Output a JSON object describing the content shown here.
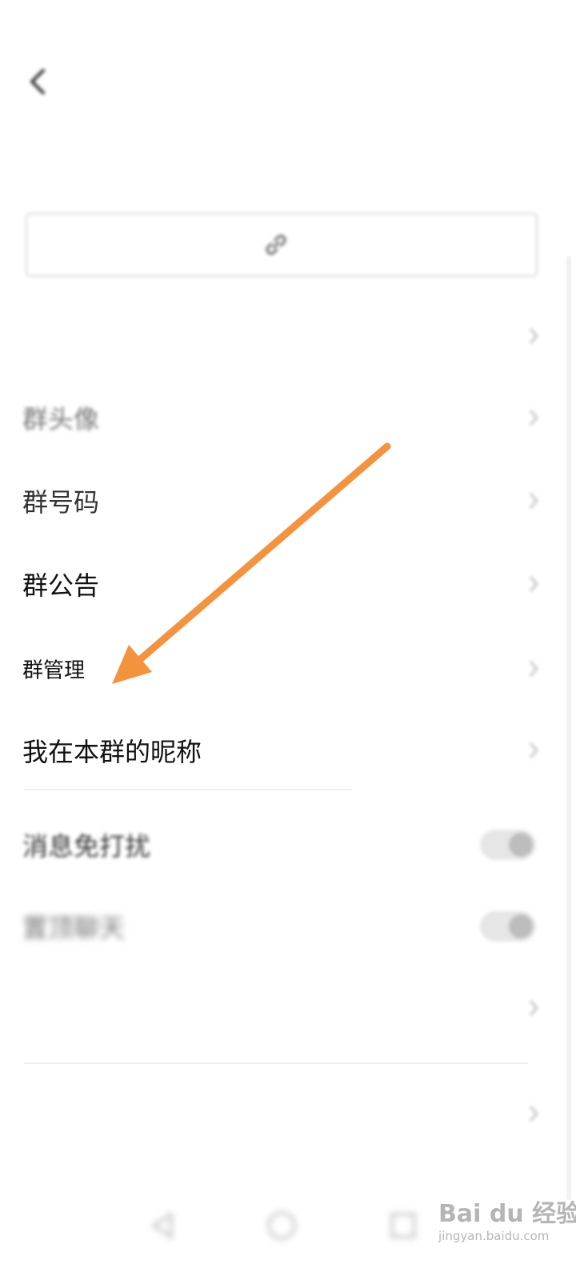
{
  "status_bar": {
    "left_text": "",
    "right_text": ""
  },
  "nav": {
    "back_icon": "chevron-left-icon",
    "title": ""
  },
  "header": {
    "subtitle": ""
  },
  "share_button": {
    "icon": "link-icon",
    "label": ""
  },
  "settings": {
    "group_name": {
      "label": "",
      "value": ""
    },
    "group_avatar": {
      "label": "群头像",
      "value": ""
    },
    "group_number": {
      "label": "群号码",
      "value": ""
    },
    "group_announcement": {
      "label": "群公告",
      "value": ""
    },
    "group_management": {
      "label": "群管理",
      "value": ""
    },
    "my_nickname": {
      "label": "我在本群的昵称",
      "value": ""
    },
    "do_not_disturb": {
      "label": "消息免打扰",
      "enabled": false
    },
    "pin_chat": {
      "label": "置顶聊天",
      "enabled": false
    },
    "report": {
      "label": ""
    },
    "exit_group": {
      "label": ""
    }
  },
  "system_nav": {
    "back_icon": "triangle-back-icon",
    "home_icon": "circle-home-icon",
    "recent_icon": "square-recent-icon"
  },
  "watermark": {
    "main": "Bai du 经验",
    "sub": "jingyan.baidu.com"
  },
  "colors": {
    "arrow": "#f5923e",
    "text": "#111111",
    "muted": "#888888"
  }
}
